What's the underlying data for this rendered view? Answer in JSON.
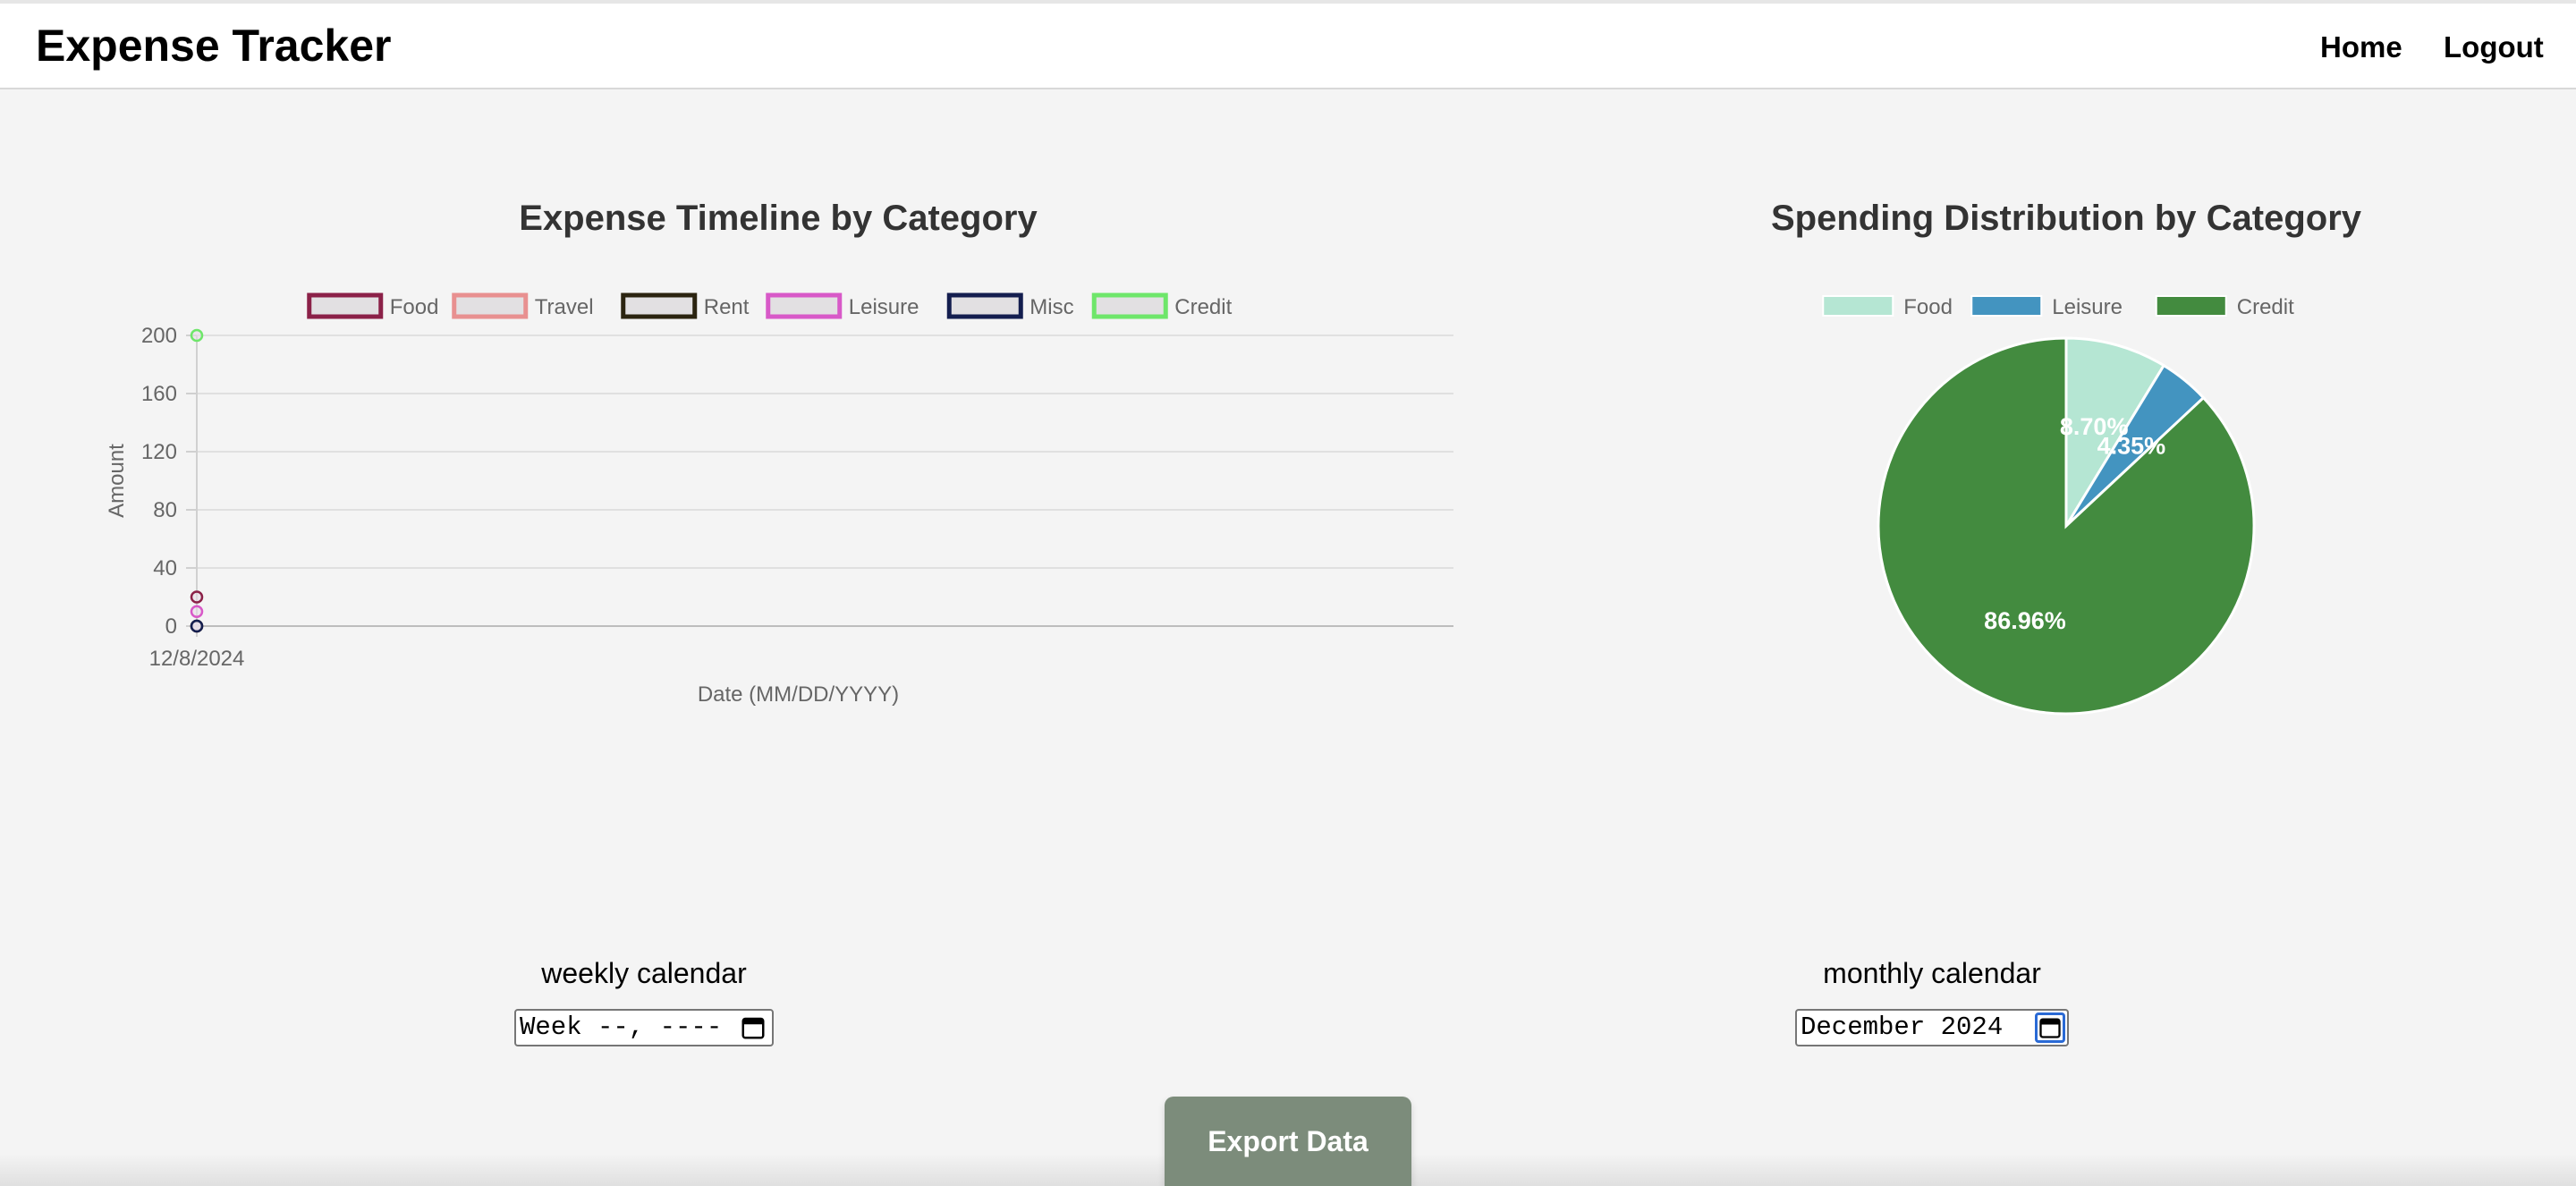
{
  "app": {
    "title": "Expense Tracker"
  },
  "nav": {
    "home": "Home",
    "logout": "Logout"
  },
  "charts": {
    "line_title": "Expense Timeline by Category",
    "pie_title": "Spending Distribution by Category"
  },
  "chart_data": [
    {
      "type": "line",
      "title": "Expense Timeline by Category",
      "xlabel": "Date (MM/DD/YYYY)",
      "ylabel": "Amount",
      "ylim": [
        0,
        200
      ],
      "yticks": [
        "0",
        "40",
        "80",
        "120",
        "160",
        "200"
      ],
      "categories": [
        "12/8/2024"
      ],
      "grid": true,
      "legend": "top",
      "series": [
        {
          "name": "Food",
          "values": [
            20
          ],
          "color": "#8b2148"
        },
        {
          "name": "Travel",
          "values": [
            0
          ],
          "color": "#e89090"
        },
        {
          "name": "Rent",
          "values": [
            0
          ],
          "color": "#2b2410"
        },
        {
          "name": "Leisure",
          "values": [
            10
          ],
          "color": "#d859c8"
        },
        {
          "name": "Misc",
          "values": [
            0
          ],
          "color": "#141e4f"
        },
        {
          "name": "Credit",
          "values": [
            200
          ],
          "color": "#6ee66a"
        }
      ]
    },
    {
      "type": "pie",
      "title": "Spending Distribution by Category",
      "legend": "top",
      "labels": [
        "Food",
        "Leisure",
        "Credit"
      ],
      "values": [
        8.7,
        4.35,
        86.96
      ],
      "value_labels": [
        "8.70%",
        "4.35%",
        "86.96%"
      ],
      "colors": [
        "#b5e6d3",
        "#4394c0",
        "#438b3f"
      ]
    }
  ],
  "calendars": {
    "weekly_label": "weekly calendar",
    "weekly_value": "Week --, ----",
    "monthly_label": "monthly calendar",
    "monthly_value": "December 2024"
  },
  "actions": {
    "export": "Export Data"
  }
}
